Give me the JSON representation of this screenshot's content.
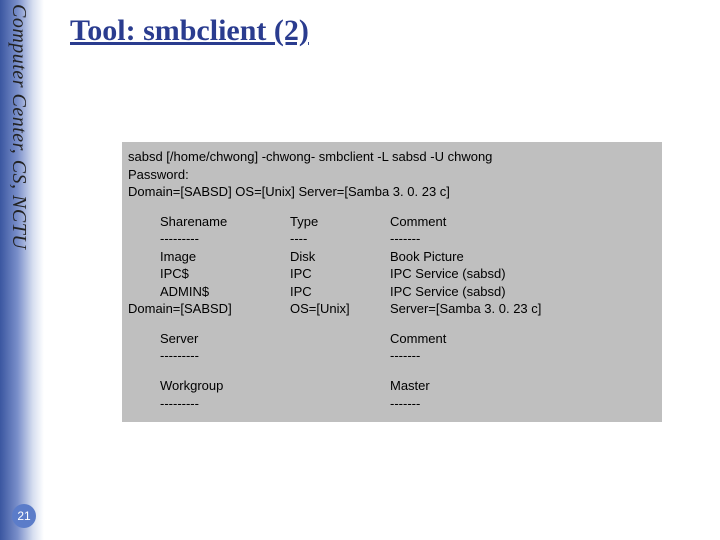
{
  "sidebar": {
    "affiliation": "Computer Center, CS, NCTU",
    "page": "21"
  },
  "header": {
    "title": "Tool: smbclient (2)"
  },
  "terminal": {
    "prompt_line": "sabsd [/home/chwong] -chwong- smbclient -L sabsd -U chwong",
    "password_line": "Password:",
    "domain_line1": "Domain=[SABSD] OS=[Unix] Server=[Samba 3. 0. 23 c]",
    "share_headers": [
      "Sharename",
      "Type",
      "Comment"
    ],
    "dividers": [
      "---------",
      "----",
      "-------"
    ],
    "shares": [
      {
        "name": "Image",
        "type": "Disk",
        "comment": "Book Picture"
      },
      {
        "name": "IPC$",
        "type": "IPC",
        "comment": "IPC Service (sabsd)"
      },
      {
        "name": "ADMIN$",
        "type": "IPC",
        "comment": "IPC Service (sabsd)"
      }
    ],
    "domain_line2": {
      "c1": "Domain=[SABSD]",
      "c2": "OS=[Unix]",
      "c3": "Server=[Samba 3. 0. 23 c]"
    },
    "server_headers": [
      "Server",
      "Comment"
    ],
    "server_dividers": [
      "---------",
      "-------"
    ],
    "workgroup_headers": [
      "Workgroup",
      "Master"
    ],
    "workgroup_dividers": [
      "---------",
      "-------"
    ]
  }
}
